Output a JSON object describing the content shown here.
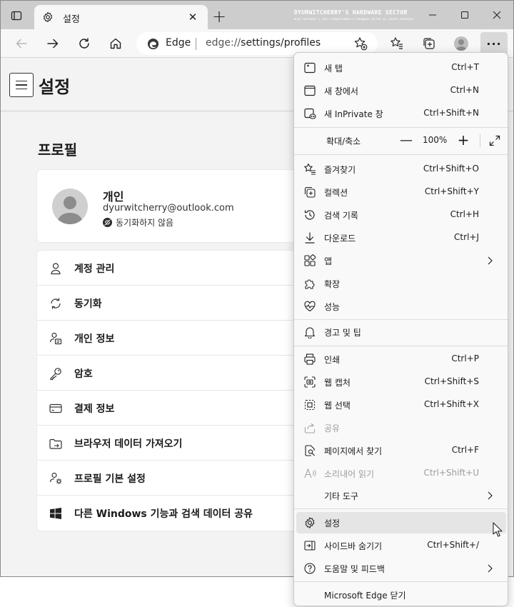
{
  "browser": {
    "tab": {
      "title": "설정",
      "close": "✕"
    },
    "new_tab": "+",
    "watermark": {
      "title": "DYURWITCHERRY'S HARDWARE SECTOR",
      "subtitle": "BLOG COPYRIGHT © 2021 DYURWITCHERRY'S HARDWARE SECTOR ALL RIGHTS RESERVED"
    },
    "address": {
      "site": "Edge",
      "url_prefix": "edge://",
      "url_path": "settings/profiles"
    },
    "more": "···"
  },
  "settings": {
    "title": "설정",
    "section": "프로필",
    "profile": {
      "name": "개인",
      "email": "dyurwitcherry@outlook.com",
      "sync": "동기화하지 않음"
    },
    "items": [
      {
        "label": "계정 관리",
        "icon": "person-icon"
      },
      {
        "label": "동기화",
        "icon": "sync-icon"
      },
      {
        "label": "개인 정보",
        "icon": "personal-info-icon"
      },
      {
        "label": "암호",
        "icon": "key-icon"
      },
      {
        "label": "결제 정보",
        "icon": "card-icon"
      },
      {
        "label": "브라우저 데이터 가져오기",
        "icon": "import-icon"
      },
      {
        "label": "프로필 기본 설정",
        "icon": "profile-settings-icon"
      },
      {
        "label": "다른 Windows 기능과 검색 데이터 공유",
        "icon": "windows-icon"
      }
    ]
  },
  "menu": {
    "new_tab": {
      "label": "새 탭",
      "shortcut": "Ctrl+T"
    },
    "new_window": {
      "label": "새 창에서",
      "shortcut": "Ctrl+N"
    },
    "new_inprivate": {
      "label": "새 InPrivate 창",
      "shortcut": "Ctrl+Shift+N"
    },
    "zoom": {
      "label": "확대/축소",
      "minus": "—",
      "value": "100%",
      "plus": "+"
    },
    "favorites": {
      "label": "즐겨찾기",
      "shortcut": "Ctrl+Shift+O"
    },
    "collections": {
      "label": "컬렉션",
      "shortcut": "Ctrl+Shift+Y"
    },
    "history": {
      "label": "검색 기록",
      "shortcut": "Ctrl+H"
    },
    "downloads": {
      "label": "다운로드",
      "shortcut": "Ctrl+J"
    },
    "apps": {
      "label": "앱"
    },
    "extensions": {
      "label": "확장"
    },
    "performance": {
      "label": "성능"
    },
    "alerts": {
      "label": "경고 및 팁"
    },
    "print": {
      "label": "인쇄",
      "shortcut": "Ctrl+P"
    },
    "web_capture": {
      "label": "웹 캡처",
      "shortcut": "Ctrl+Shift+S"
    },
    "web_select": {
      "label": "웹 선택",
      "shortcut": "Ctrl+Shift+X"
    },
    "share": {
      "label": "공유"
    },
    "find": {
      "label": "페이지에서 찾기",
      "shortcut": "Ctrl+F"
    },
    "read_aloud": {
      "label": "소리내어 읽기",
      "shortcut": "Ctrl+Shift+U"
    },
    "more_tools": {
      "label": "기타 도구"
    },
    "settings": {
      "label": "설정"
    },
    "hide_sidebar": {
      "label": "사이드바 숨기기",
      "shortcut": "Ctrl+Shift+/"
    },
    "help": {
      "label": "도움말 및 피드백"
    },
    "close_edge": {
      "label": "Microsoft Edge 닫기"
    }
  },
  "colors": {
    "tabbar": "#cdcdcd",
    "menu_bg": "#f9f9f9",
    "hover": "#e5e5e5",
    "disabled": "#9c9c9c"
  }
}
